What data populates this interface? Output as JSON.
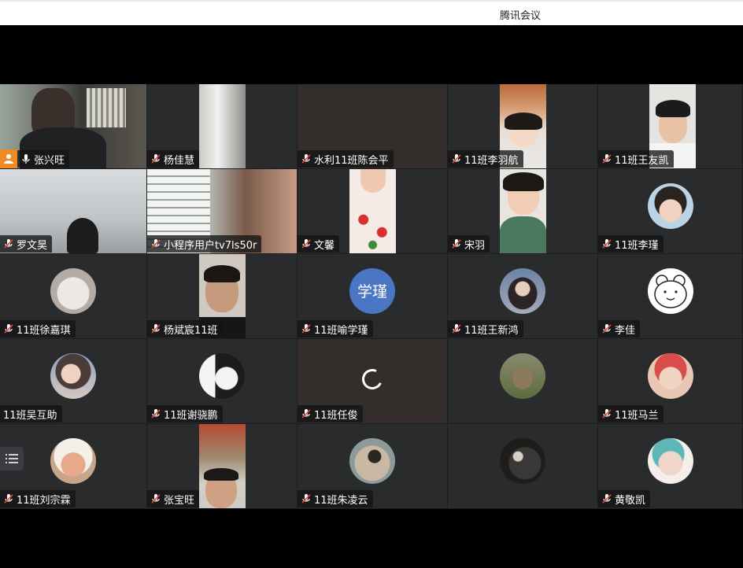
{
  "window": {
    "title": "腾讯会议"
  },
  "colors": {
    "host_badge": "#f08a24",
    "mic_muted": "#e04a3a",
    "avatar_text_bg": "#4a76c4"
  },
  "participants": [
    {
      "name": "张兴旺",
      "role": "host",
      "mic": "on"
    },
    {
      "name": "杨佳慧",
      "mic": "muted"
    },
    {
      "name": "水利11班陈会平",
      "mic": "muted"
    },
    {
      "name": "11班李羽航",
      "mic": "muted"
    },
    {
      "name": "11班王友凯",
      "mic": "muted"
    },
    {
      "name": "罗文昊",
      "mic": "muted"
    },
    {
      "name": "小程序用户tv7ls50r",
      "mic": "muted"
    },
    {
      "name": "文馨",
      "mic": "muted"
    },
    {
      "name": "宋羽",
      "mic": "muted"
    },
    {
      "name": "11班李瑾",
      "mic": "muted"
    },
    {
      "name": "11班徐嘉琪",
      "mic": "muted"
    },
    {
      "name": "杨斌宸11班",
      "mic": "muted"
    },
    {
      "name": "11班喻学瑾",
      "mic": "muted",
      "avatar_text": "学瑾"
    },
    {
      "name": "11班王新鸿",
      "mic": "muted"
    },
    {
      "name": "李佳",
      "mic": "muted"
    },
    {
      "name": "11班吴互助",
      "mic": "muted"
    },
    {
      "name": "11班谢骁鹏",
      "mic": "muted"
    },
    {
      "name": "11班任俊",
      "mic": "muted",
      "state": "loading"
    },
    {
      "name": "",
      "mic": "none"
    },
    {
      "name": "11班马兰",
      "mic": "muted"
    },
    {
      "name": "11班刘宗霖",
      "mic": "muted"
    },
    {
      "name": "张宝旺",
      "mic": "muted"
    },
    {
      "name": "11班朱凌云",
      "mic": "muted"
    },
    {
      "name": "",
      "mic": "none"
    },
    {
      "name": "黄敬凯",
      "mic": "muted"
    }
  ]
}
